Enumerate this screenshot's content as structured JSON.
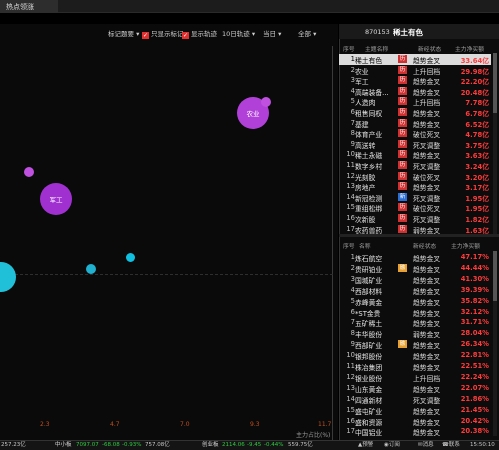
{
  "window": {
    "tab_title": "热点领涨"
  },
  "toolbar": {
    "filter_label": "标记题要",
    "only_show_label": "只显示标记",
    "show_trajectory_label": "显示轨迹",
    "trajectory_days": "10日轨迹",
    "period": "当日",
    "scope": "全部"
  },
  "plot": {
    "x_ticks": [
      "2.3",
      "4.7",
      "7.0",
      "9.3",
      "11.7"
    ],
    "x_axis_label": "主力占比(%)",
    "bubbles": [
      {
        "label": "农业",
        "color": "#b040d8"
      },
      {
        "label": "",
        "color": "#c050e0"
      },
      {
        "label": "军工",
        "color": "#a030d0"
      },
      {
        "label": "",
        "color": "#c050e0"
      },
      {
        "label": "",
        "color": "#20c0d8"
      },
      {
        "label": "",
        "color": "#20b0d0"
      },
      {
        "label": "",
        "color": "#10c0e0"
      }
    ]
  },
  "top_panel": {
    "code": "870153",
    "name": "稀土有色",
    "headers": [
      "序号",
      "主题名称",
      "新经状态",
      "主力净买额"
    ],
    "rows": [
      {
        "idx": "1",
        "name": "稀土有色",
        "tag": "历",
        "state": "趋势金叉",
        "value": "33.64亿"
      },
      {
        "idx": "2",
        "name": "农业",
        "tag": "历",
        "state": "上升回档",
        "value": "29.98亿"
      },
      {
        "idx": "3",
        "name": "军工",
        "tag": "历",
        "state": "趋势金叉",
        "value": "22.20亿"
      },
      {
        "idx": "4",
        "name": "高端装备...",
        "tag": "历",
        "state": "趋势金叉",
        "value": "20.48亿"
      },
      {
        "idx": "5",
        "name": "人造肉",
        "tag": "历",
        "state": "上升回档",
        "value": "7.78亿"
      },
      {
        "idx": "6",
        "name": "租售同权",
        "tag": "历",
        "state": "趋势金叉",
        "value": "6.78亿"
      },
      {
        "idx": "7",
        "name": "基建",
        "tag": "历",
        "state": "趋势金叉",
        "value": "6.52亿"
      },
      {
        "idx": "8",
        "name": "体育产业",
        "tag": "历",
        "state": "破位死叉",
        "value": "4.78亿"
      },
      {
        "idx": "9",
        "name": "高送转",
        "tag": "历",
        "state": "死叉调整",
        "value": "3.75亿"
      },
      {
        "idx": "10",
        "name": "稀土永磁",
        "tag": "历",
        "state": "趋势金叉",
        "value": "3.63亿"
      },
      {
        "idx": "11",
        "name": "数字乡村",
        "tag": "历",
        "state": "死叉调整",
        "value": "3.24亿"
      },
      {
        "idx": "12",
        "name": "光刻胶",
        "tag": "历",
        "state": "破位死叉",
        "value": "3.20亿"
      },
      {
        "idx": "13",
        "name": "房地产",
        "tag": "历",
        "state": "趋势金叉",
        "value": "3.17亿"
      },
      {
        "idx": "14",
        "name": "新冠检测",
        "tag": "新",
        "state": "死叉调整",
        "value": "1.95亿"
      },
      {
        "idx": "15",
        "name": "重组松绑",
        "tag": "历",
        "state": "破位死叉",
        "value": "1.95亿"
      },
      {
        "idx": "16",
        "name": "次新股",
        "tag": "历",
        "state": "死叉调整",
        "value": "1.82亿"
      },
      {
        "idx": "17",
        "name": "农药兽药",
        "tag": "历",
        "state": "弱势金叉",
        "value": "1.63亿"
      }
    ]
  },
  "bottom_panel": {
    "headers": [
      "序号",
      "名称",
      "新经状态",
      "主力净买额"
    ],
    "rows": [
      {
        "idx": "1",
        "name": "炼石航空",
        "tag": "",
        "state": "趋势金叉",
        "value": "47.17%"
      },
      {
        "idx": "2",
        "name": "贵研铂业",
        "tag": "融",
        "state": "趋势金叉",
        "value": "44.44%"
      },
      {
        "idx": "3",
        "name": "国城矿业",
        "tag": "",
        "state": "趋势金叉",
        "value": "41.30%"
      },
      {
        "idx": "4",
        "name": "西部材料",
        "tag": "",
        "state": "趋势金叉",
        "value": "39.39%"
      },
      {
        "idx": "5",
        "name": "赤峰黄金",
        "tag": "",
        "state": "趋势金叉",
        "value": "35.82%"
      },
      {
        "idx": "6",
        "name": "*ST金贵",
        "tag": "",
        "state": "趋势金叉",
        "value": "32.12%"
      },
      {
        "idx": "7",
        "name": "五矿稀土",
        "tag": "",
        "state": "趋势金叉",
        "value": "31.71%"
      },
      {
        "idx": "8",
        "name": "丰华股份",
        "tag": "",
        "state": "弱势金叉",
        "value": "28.04%"
      },
      {
        "idx": "9",
        "name": "西部矿业",
        "tag": "融",
        "state": "趋势金叉",
        "value": "26.34%"
      },
      {
        "idx": "10",
        "name": "银邦股份",
        "tag": "",
        "state": "趋势金叉",
        "value": "22.81%"
      },
      {
        "idx": "11",
        "name": "株冶集团",
        "tag": "",
        "state": "趋势金叉",
        "value": "22.51%"
      },
      {
        "idx": "12",
        "name": "银业股份",
        "tag": "",
        "state": "上升回档",
        "value": "22.24%"
      },
      {
        "idx": "13",
        "name": "山东黄金",
        "tag": "",
        "state": "趋势金叉",
        "value": "22.07%"
      },
      {
        "idx": "14",
        "name": "四通新材",
        "tag": "",
        "state": "死叉调整",
        "value": "21.86%"
      },
      {
        "idx": "15",
        "name": "盛屯矿业",
        "tag": "",
        "state": "趋势金叉",
        "value": "21.45%"
      },
      {
        "idx": "16",
        "name": "盛和资源",
        "tag": "",
        "state": "趋势金叉",
        "value": "20.42%"
      },
      {
        "idx": "17",
        "name": "中国铝业",
        "tag": "",
        "state": "趋势金叉",
        "value": "20.38%"
      }
    ]
  },
  "statusbar": {
    "idx1_value": "257.23亿",
    "sme_label": "中小板",
    "sme_index": "7097.07",
    "sme_change": "-68.08",
    "sme_pct": "-0.93%",
    "sme_amount": "757.08亿",
    "gem_label": "创业板",
    "gem_index": "2114.06",
    "gem_change": "-9.45",
    "gem_pct": "-0.44%",
    "gem_amount": "559.75亿",
    "btn_warn": "预警",
    "btn_sub": "订阅",
    "btn_news": "消息",
    "btn_contact": "联系",
    "clock": "15:50:10"
  }
}
